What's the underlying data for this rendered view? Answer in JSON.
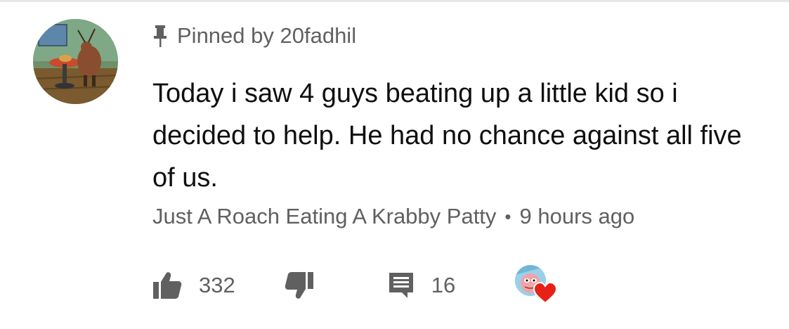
{
  "pinned": {
    "icon": "pin-icon",
    "label": "Pinned by 20fadhil"
  },
  "comment": {
    "text": "Today i saw 4 guys beating up a little kid so i decided to help. He had no chance against all five of us.",
    "author": "Just A Roach Eating A Krabby Patty",
    "separator": "•",
    "time": "9 hours ago"
  },
  "actions": {
    "like_icon": "thumbs-up-icon",
    "like_count": "332",
    "dislike_icon": "thumbs-down-icon",
    "reply_icon": "comment-icon",
    "reply_count": "16",
    "creator_heart_icon": "heart-icon"
  },
  "colors": {
    "text_primary": "#0f0f0f",
    "text_secondary": "#606060",
    "heart": "#e62117"
  }
}
